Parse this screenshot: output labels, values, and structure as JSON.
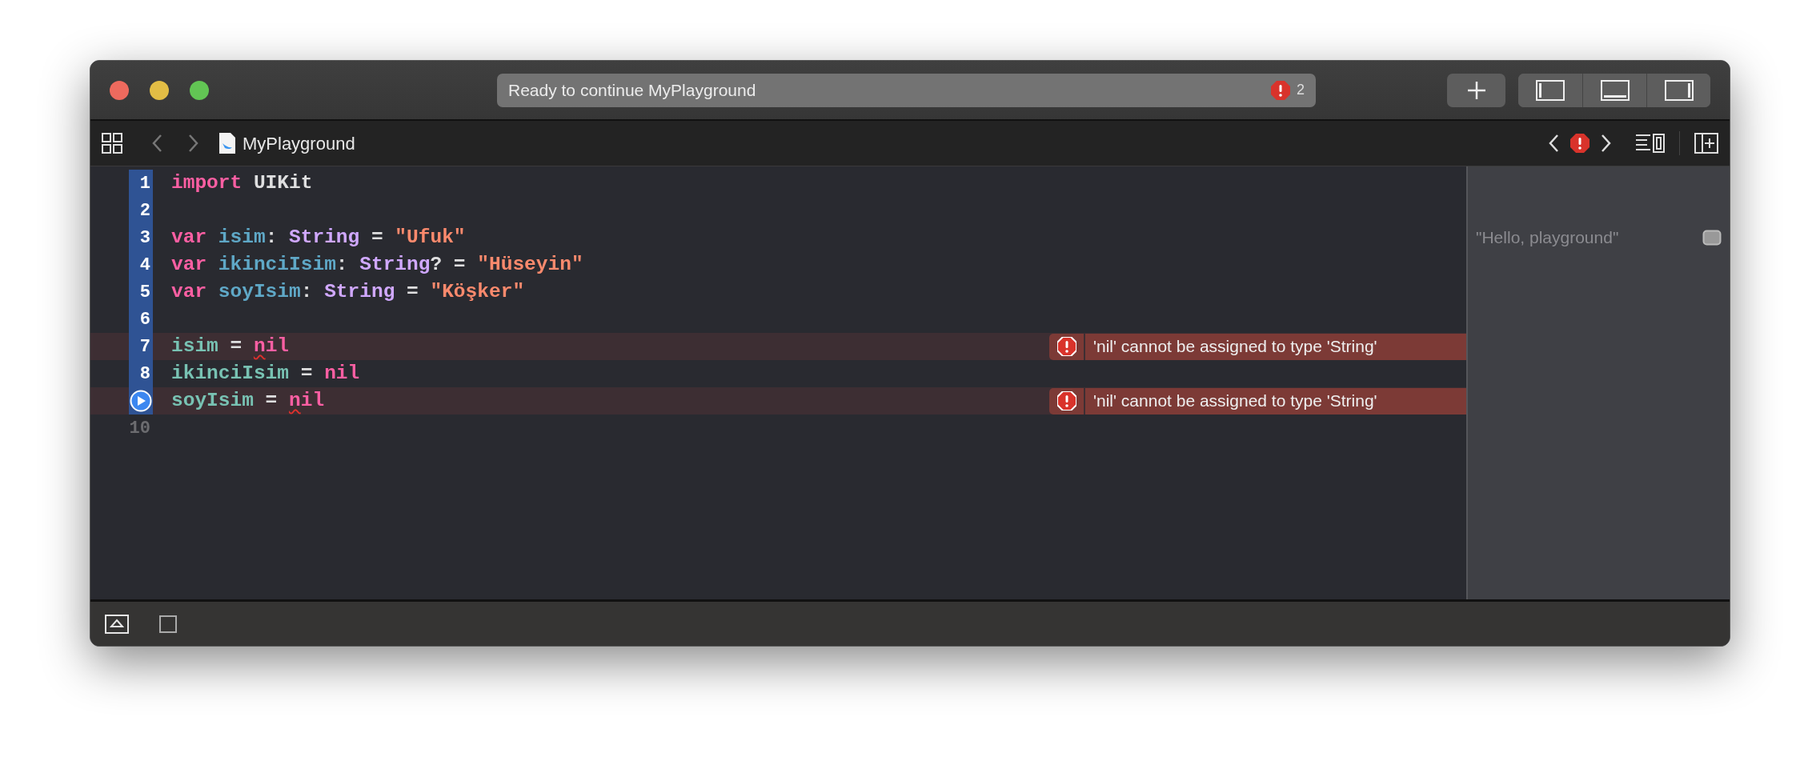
{
  "window": {
    "status": "Ready to continue MyPlayground",
    "error_count": "2"
  },
  "toolbar": {
    "file_name": "MyPlayground"
  },
  "editor": {
    "lines": [
      {
        "number": "1",
        "in_range": true,
        "current": false,
        "error": false,
        "tokens": [
          {
            "kind": "keyword",
            "text": "import"
          },
          {
            "kind": "plain",
            "text": " UIKit"
          }
        ]
      },
      {
        "number": "2",
        "in_range": true,
        "current": false,
        "error": false
      },
      {
        "number": "3",
        "in_range": true,
        "current": false,
        "error": false,
        "result": "\"Hello, playground\"",
        "tokens": [
          {
            "kind": "keyword",
            "text": "var"
          },
          {
            "kind": "declaration",
            "text": " isim"
          },
          {
            "kind": "plain",
            "text": ": "
          },
          {
            "kind": "type",
            "text": "String"
          },
          {
            "kind": "plain",
            "text": " = "
          },
          {
            "kind": "string",
            "text": "\"Ufuk\""
          }
        ]
      },
      {
        "number": "4",
        "in_range": true,
        "current": false,
        "error": false,
        "tokens": [
          {
            "kind": "keyword",
            "text": "var"
          },
          {
            "kind": "declaration",
            "text": " ikinciIsim"
          },
          {
            "kind": "plain",
            "text": ": "
          },
          {
            "kind": "type",
            "text": "String"
          },
          {
            "kind": "plain",
            "text": "? = "
          },
          {
            "kind": "string",
            "text": "\"Hüseyin\""
          }
        ]
      },
      {
        "number": "5",
        "in_range": true,
        "current": false,
        "error": false,
        "tokens": [
          {
            "kind": "keyword",
            "text": "var"
          },
          {
            "kind": "declaration",
            "text": " soyIsim"
          },
          {
            "kind": "plain",
            "text": ": "
          },
          {
            "kind": "type",
            "text": "String"
          },
          {
            "kind": "plain",
            "text": " = "
          },
          {
            "kind": "string",
            "text": "\"Köşker\""
          }
        ]
      },
      {
        "number": "6",
        "in_range": true,
        "current": false,
        "error": false
      },
      {
        "number": "7",
        "in_range": true,
        "current": false,
        "error": true,
        "error_message": "'nil' cannot be assigned to type 'String'",
        "tokens": [
          {
            "kind": "variable",
            "text": "isim"
          },
          {
            "kind": "plain",
            "text": " = "
          },
          {
            "kind": "keyword",
            "text": "n",
            "squiggle": true
          },
          {
            "kind": "keyword",
            "text": "il"
          }
        ]
      },
      {
        "number": "8",
        "in_range": true,
        "current": false,
        "error": false,
        "tokens": [
          {
            "kind": "variable",
            "text": "ikinciIsim"
          },
          {
            "kind": "plain",
            "text": " = "
          },
          {
            "kind": "keyword",
            "text": "nil"
          }
        ]
      },
      {
        "in_range": true,
        "current": true,
        "error": true,
        "error_message": "'nil' cannot be assigned to type 'String'",
        "tokens": [
          {
            "kind": "variable",
            "text": "soyIsim"
          },
          {
            "kind": "plain",
            "text": " = "
          },
          {
            "kind": "keyword",
            "text": "n",
            "squiggle": true
          },
          {
            "kind": "keyword",
            "text": "il"
          }
        ]
      },
      {
        "number": "10",
        "in_range": false,
        "current": false,
        "error": false
      }
    ]
  }
}
